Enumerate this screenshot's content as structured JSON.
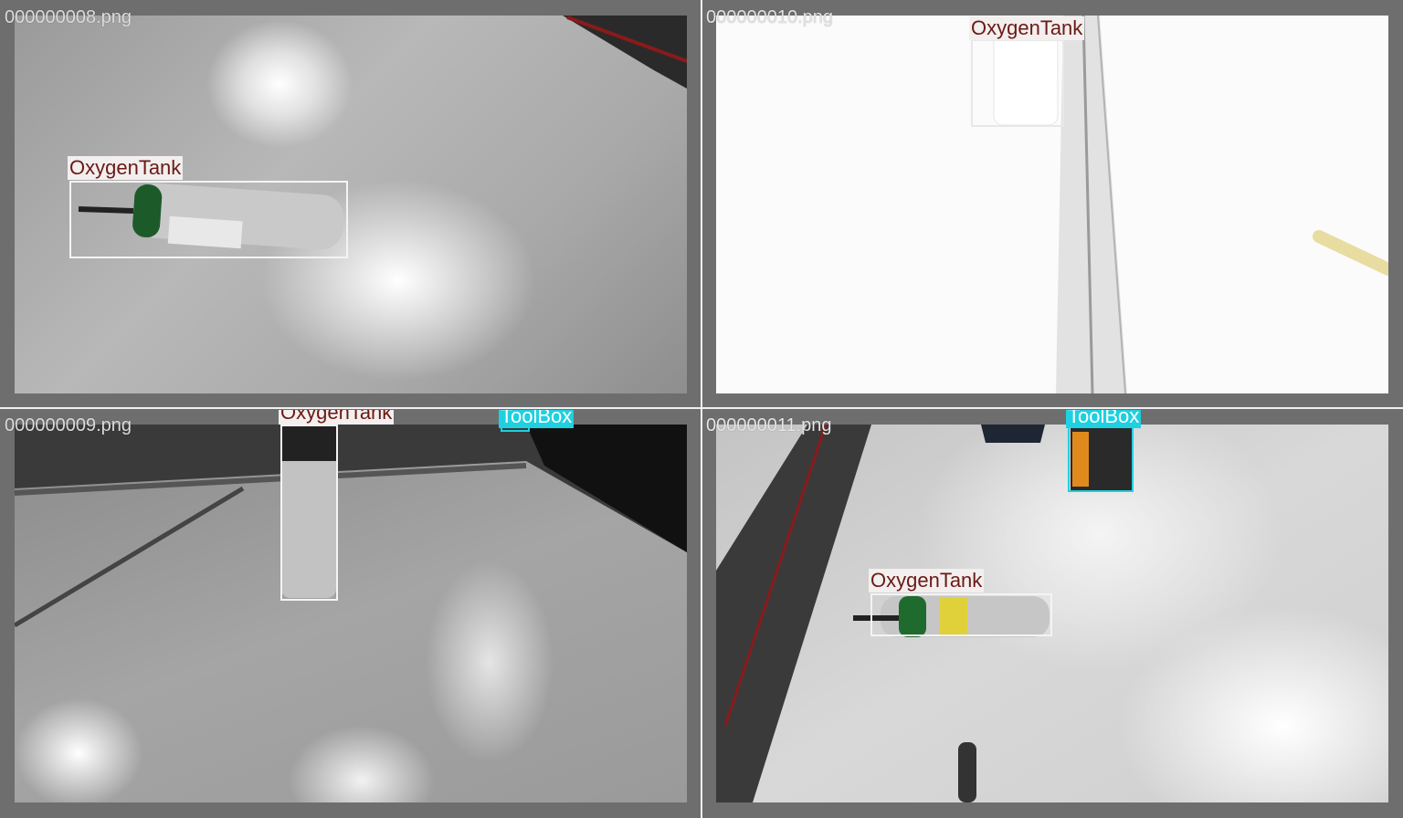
{
  "tiles": [
    {
      "filename": "000000008.png"
    },
    {
      "filename": "000000010.png"
    },
    {
      "filename": "000000009.png"
    },
    {
      "filename": "000000011.png"
    }
  ],
  "classes": {
    "oxygen_tank": {
      "label": "OxygenTank",
      "color": "#6b1a16",
      "label_bg": "#f2efee"
    },
    "toolbox": {
      "label": "ToolBox",
      "color": "#1fd0e0"
    }
  }
}
